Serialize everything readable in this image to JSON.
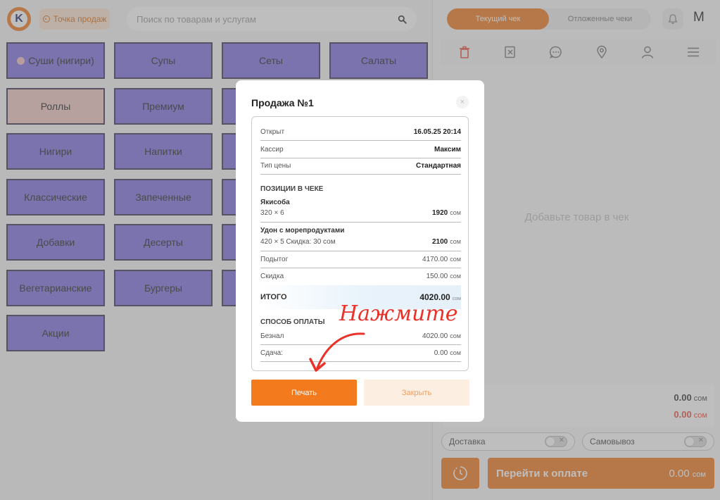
{
  "header": {
    "logo_letter": "K",
    "pos_label": "Точка продаж",
    "search_placeholder": "Поиск по товарам и услугам"
  },
  "categories": [
    {
      "label": "Суши (нигири)"
    },
    {
      "label": "Супы"
    },
    {
      "label": "Сеты"
    },
    {
      "label": "Салаты"
    },
    {
      "label": "Роллы"
    },
    {
      "label": "Премиум"
    },
    {
      "label": "Нигири"
    },
    {
      "label": "Напитки"
    },
    {
      "label": "Классические"
    },
    {
      "label": "Запеченные"
    },
    {
      "label": "Добавки"
    },
    {
      "label": "Десерты"
    },
    {
      "label": "Вегетарианские"
    },
    {
      "label": "Бургеры"
    },
    {
      "label": "Акции"
    }
  ],
  "right": {
    "tabs": [
      {
        "label": "Текущий чек"
      },
      {
        "label": "Отложенные чеки"
      }
    ],
    "user_initial": "M",
    "empty_text": "Добавьте товар в чек",
    "subtotal": {
      "value": "0.00",
      "unit": "сом"
    },
    "discount": {
      "value": "0.00",
      "unit": "сом"
    },
    "delivery_label": "Доставка",
    "pickup_label": "Самовывоз",
    "pay_label": "Перейти к оплате",
    "pay_value": "0.00",
    "pay_unit": "сом"
  },
  "modal": {
    "title": "Продажа №1",
    "close_glyph": "×",
    "opened_label": "Открыт",
    "opened_value": "16.05.25 20:14",
    "cashier_label": "Кассир",
    "cashier_value": "Максим",
    "price_type_label": "Тип цены",
    "price_type_value": "Стандартная",
    "items_header": "ПОЗИЦИИ В ЧЕКЕ",
    "items": [
      {
        "name": "Якисоба",
        "detail": "320 × 6",
        "amount": "1920",
        "unit": "сом"
      },
      {
        "name": "Удон с морепродуктами",
        "detail": "420 × 5 Скидка: 30 сом",
        "amount": "2100",
        "unit": "сом"
      }
    ],
    "subtotal_label": "Подытог",
    "subtotal_value": "4170.00",
    "subtotal_unit": "сом",
    "discount_label": "Скидка",
    "discount_value": "150.00",
    "discount_unit": "сом",
    "total_label": "ИТОГО",
    "total_value": "4020.00",
    "total_unit": "сом",
    "payment_header": "СПОСОБ ОПЛАТЫ",
    "cashless_label": "Безнал",
    "cashless_value": "4020.00",
    "cashless_unit": "сом",
    "change_label": "Сдача:",
    "change_value": "0.00",
    "change_unit": "сом",
    "print_label": "Печать",
    "close_label": "Закрыть"
  },
  "annotation": {
    "text": "Нажмите",
    "color": "#e8322a"
  },
  "colors": {
    "accent": "#f07a1e",
    "category": "#7e6fe0",
    "category_active": "#f1c7c2"
  }
}
